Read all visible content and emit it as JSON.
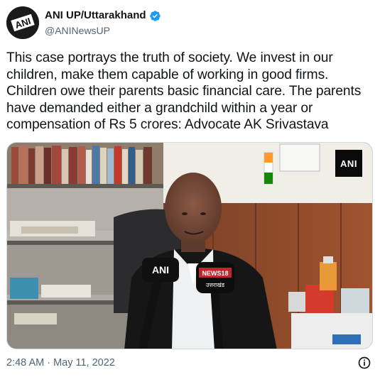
{
  "account": {
    "display_name": "ANI UP/Uttarakhand",
    "handle": "@ANINewsUP",
    "avatar_text": "ANI"
  },
  "tweet": {
    "text": "This case portrays the truth of society. We invest in our children, make them capable of working in good firms. Children owe their parents basic financial care. The parents have demanded either a grandchild within a year or compensation of Rs 5 crores: Advocate AK Srivastava",
    "timestamp": "2:48 AM · May 11, 2022"
  },
  "media": {
    "watermark": "ANI",
    "mic_left_label": "ANI",
    "mic_right_label_top": "NEWS18",
    "mic_right_label_bottom": "उत्तराखंड"
  },
  "icons": {
    "verified": "verified-badge-icon",
    "info": "info-icon"
  },
  "colors": {
    "verified_blue": "#1d9bf0",
    "secondary_text": "#536471",
    "primary_text": "#0f1419"
  }
}
